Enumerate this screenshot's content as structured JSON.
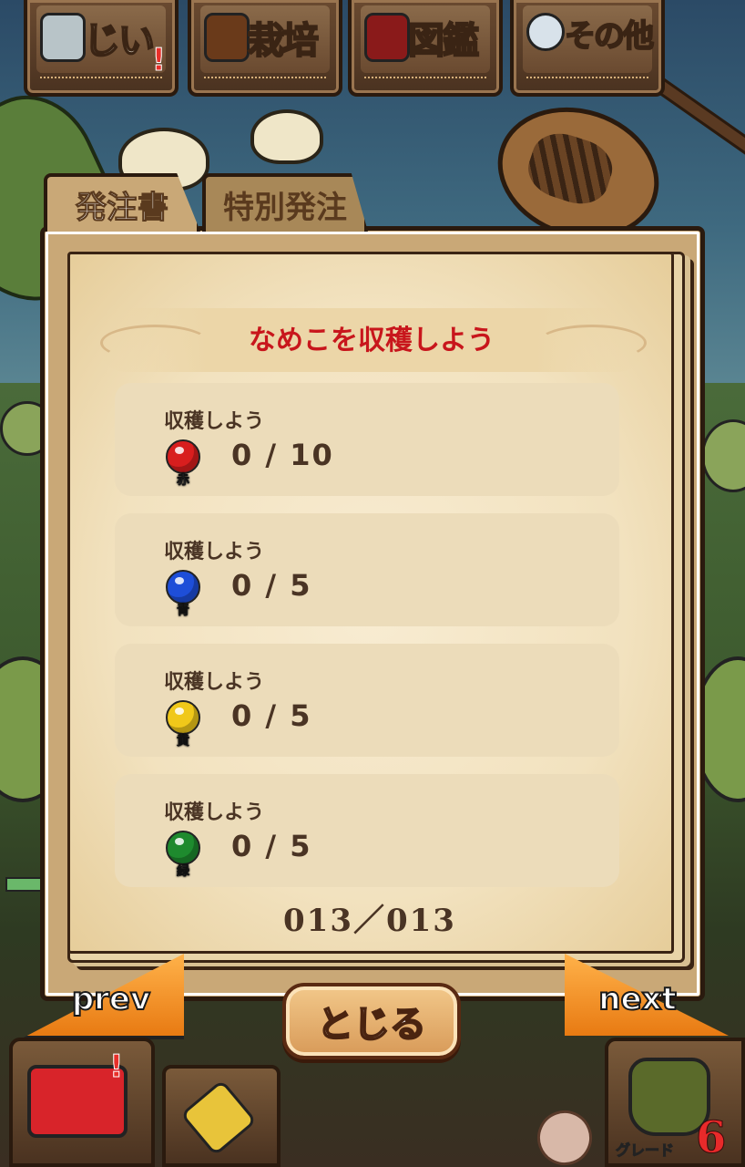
{
  "top_menu": [
    {
      "label": "じい",
      "icon": "fish-icon",
      "alert": "!"
    },
    {
      "label": "栽培",
      "icon": "acorn-icon"
    },
    {
      "label": "図鑑",
      "icon": "book-icon"
    },
    {
      "label": "その他",
      "icon": "magnifier-icon"
    }
  ],
  "tabs": {
    "active": "発注書",
    "inactive": "特別発注"
  },
  "order": {
    "title": "なめこを収穫しよう",
    "tasks": [
      {
        "label": "収穫しよう",
        "color_name": "赤",
        "color": "#d81e1e",
        "progress": "0 / 10"
      },
      {
        "label": "収穫しよう",
        "color_name": "青",
        "color": "#1e4ed8",
        "progress": "0 / 5"
      },
      {
        "label": "収穫しよう",
        "color_name": "黄",
        "color": "#f0c81a",
        "progress": "0 / 5"
      },
      {
        "label": "収穫しよう",
        "color_name": "緑",
        "color": "#1e8a2e",
        "progress": "0 / 5"
      }
    ],
    "page": "013／013"
  },
  "nav": {
    "prev": "prev",
    "next": "next",
    "close": "とじる"
  },
  "tray": {
    "toolbox_alert": "!",
    "grade_label": "グレード",
    "grade_value": "6"
  },
  "colors": {
    "accent_orange": "#e87a12",
    "title_red": "#c8161c",
    "paper": "#f2e2bf"
  }
}
